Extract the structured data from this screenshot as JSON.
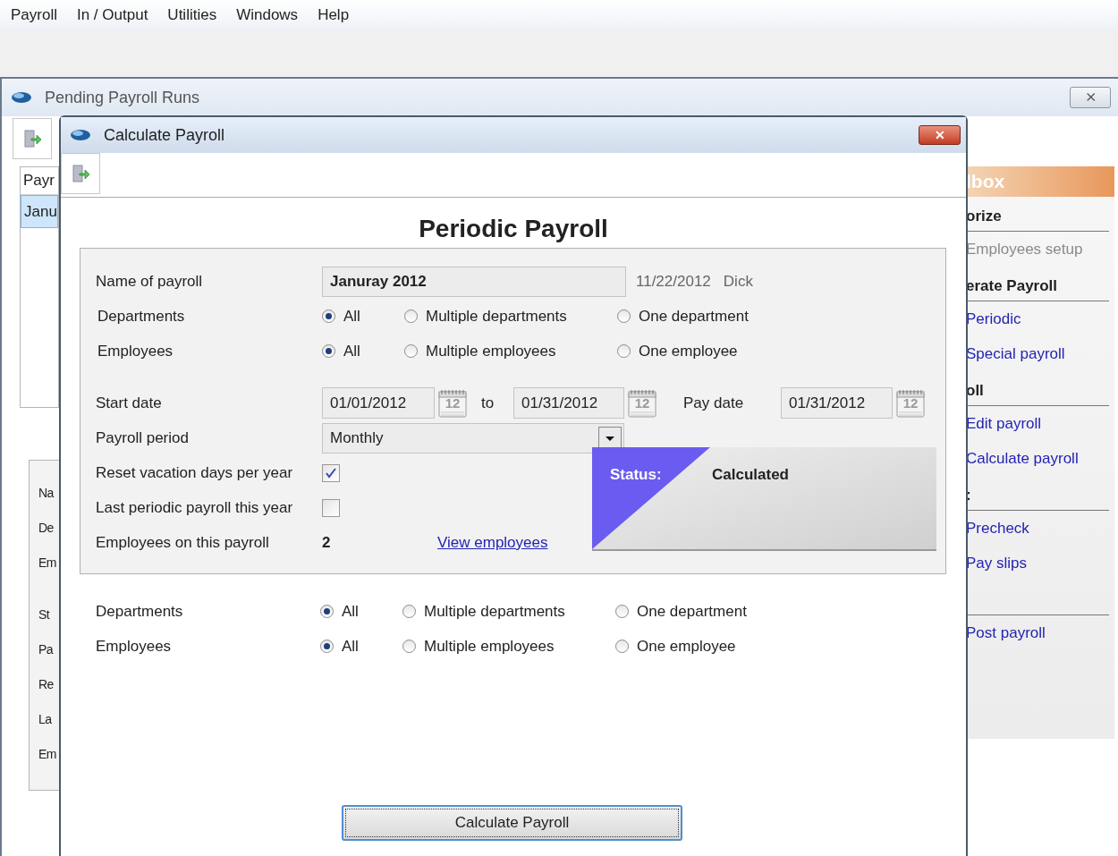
{
  "menu": [
    {
      "label": "Payroll"
    },
    {
      "label": "In / Output"
    },
    {
      "label": "Utilities"
    },
    {
      "label": "Windows"
    },
    {
      "label": "Help"
    }
  ],
  "back_window": {
    "title": "Pending Payroll Runs",
    "close_label": "⨯",
    "list": {
      "header": "Payr",
      "rows": [
        {
          "label": "Janu",
          "selected": true
        }
      ]
    },
    "form_labels": [
      "Na",
      "De",
      "Em",
      "St",
      "Pa",
      "Re",
      "La",
      "Em"
    ],
    "toolbox": {
      "title": "lbox",
      "items": [
        {
          "kind": "heading",
          "label": "orize"
        },
        {
          "kind": "disabled",
          "label": "Employees setup"
        },
        {
          "kind": "heading",
          "label": "erate Payroll"
        },
        {
          "kind": "link",
          "label": "Periodic"
        },
        {
          "kind": "link",
          "label": "Special payroll"
        },
        {
          "kind": "heading",
          "label": "oll"
        },
        {
          "kind": "link",
          "label": "Edit payroll"
        },
        {
          "kind": "link",
          "label": "Calculate payroll"
        },
        {
          "kind": "heading",
          "label": ":"
        },
        {
          "kind": "link",
          "label": "Precheck"
        },
        {
          "kind": "link",
          "label": "Pay slips"
        },
        {
          "kind": "heading"
        },
        {
          "kind": "link",
          "label": "Post payroll"
        }
      ]
    }
  },
  "dialog": {
    "title": "Calculate Payroll",
    "close_label": "✕",
    "heading": "Periodic Payroll",
    "name_row": {
      "label": "Name of payroll",
      "value": "Januray 2012",
      "date": "11/22/2012",
      "user": "Dick"
    },
    "radio_rows": [
      {
        "label": "Departments",
        "options": [
          {
            "label": "All",
            "selected": true
          },
          {
            "label": "Multiple departments",
            "selected": false
          },
          {
            "label": "One department",
            "selected": false
          }
        ]
      },
      {
        "label": "Employees",
        "options": [
          {
            "label": "All",
            "selected": true
          },
          {
            "label": "Multiple employees",
            "selected": false
          },
          {
            "label": "One employee",
            "selected": false
          }
        ]
      }
    ],
    "date_row": {
      "label": "Start date",
      "start": "01/01/2012",
      "to": "to",
      "end": "01/31/2012",
      "pay_label": "Pay date",
      "pay": "01/31/2012",
      "start_calendar": "12",
      "end_calendar": "12",
      "pay_calendar": "12"
    },
    "period": {
      "label": "Payroll period",
      "value": "Monthly"
    },
    "checks": [
      {
        "label": "Reset vacation days per year",
        "checked": true
      },
      {
        "label": "Last periodic payroll this year",
        "checked": false
      }
    ],
    "employees": {
      "label": "Employees on this payroll",
      "count": "2",
      "link": "View employees"
    },
    "status": {
      "label": "Status:",
      "value": "Calculated"
    },
    "lower_radio_rows": [
      {
        "label": "Departments",
        "options": [
          {
            "label": "All",
            "selected": true
          },
          {
            "label": "Multiple departments",
            "selected": false
          },
          {
            "label": "One department",
            "selected": false
          }
        ]
      },
      {
        "label": "Employees",
        "options": [
          {
            "label": "All",
            "selected": true
          },
          {
            "label": "Multiple employees",
            "selected": false
          },
          {
            "label": "One employee",
            "selected": false
          }
        ]
      }
    ],
    "button": "Calculate Payroll"
  }
}
